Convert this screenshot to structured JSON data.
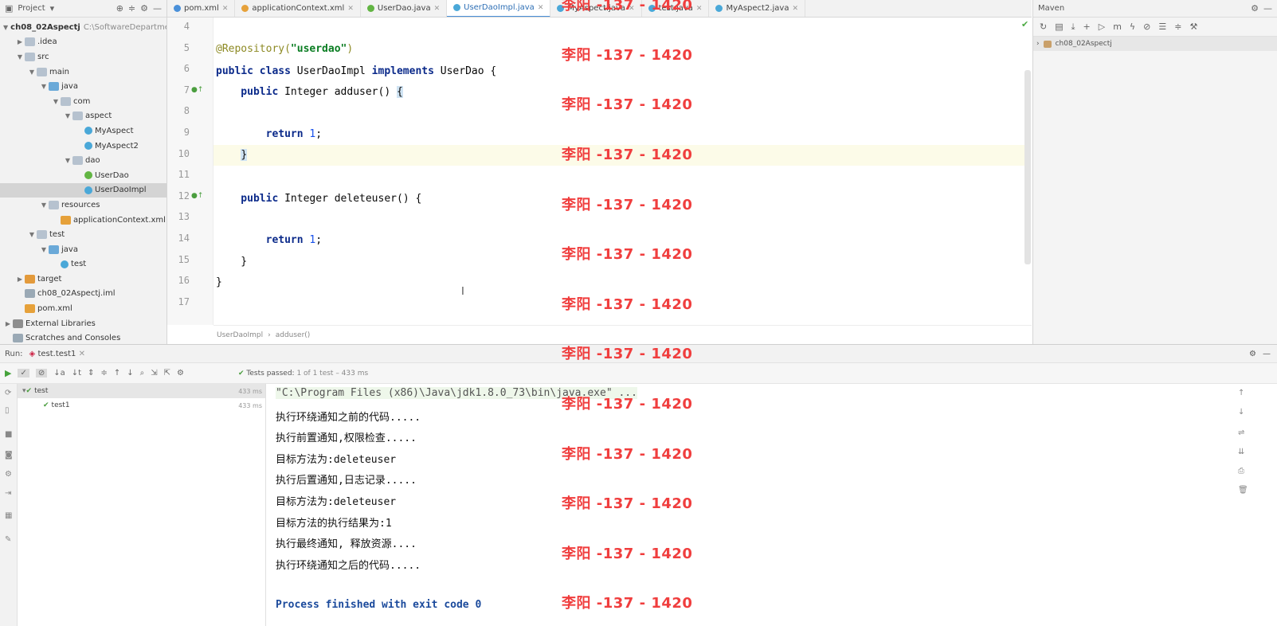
{
  "project": {
    "title": "Project",
    "tree": [
      {
        "label": "ch08_02Aspectj",
        "path": "C:\\SoftwareDepartme",
        "arrow": "v",
        "indent": 0,
        "icon": "folder",
        "bold": true
      },
      {
        "label": ".idea",
        "arrow": ">",
        "indent": 1,
        "icon": "folder"
      },
      {
        "label": "src",
        "arrow": "v",
        "indent": 1,
        "icon": "folder"
      },
      {
        "label": "main",
        "arrow": "v",
        "indent": 2,
        "icon": "folder"
      },
      {
        "label": "java",
        "arrow": "v",
        "indent": 3,
        "icon": "folder-blue"
      },
      {
        "label": "com",
        "arrow": "v",
        "indent": 4,
        "icon": "folder"
      },
      {
        "label": "aspect",
        "arrow": "v",
        "indent": 5,
        "icon": "folder"
      },
      {
        "label": "MyAspect",
        "arrow": "",
        "indent": 6,
        "icon": "class"
      },
      {
        "label": "MyAspect2",
        "arrow": "",
        "indent": 6,
        "icon": "class"
      },
      {
        "label": "dao",
        "arrow": "v",
        "indent": 5,
        "icon": "folder"
      },
      {
        "label": "UserDao",
        "arrow": "",
        "indent": 6,
        "icon": "iface"
      },
      {
        "label": "UserDaoImpl",
        "arrow": "",
        "indent": 6,
        "icon": "class",
        "selected": true
      },
      {
        "label": "resources",
        "arrow": "v",
        "indent": 3,
        "icon": "folder"
      },
      {
        "label": "applicationContext.xml",
        "arrow": "",
        "indent": 4,
        "icon": "xml"
      },
      {
        "label": "test",
        "arrow": "v",
        "indent": 2,
        "icon": "folder"
      },
      {
        "label": "java",
        "arrow": "v",
        "indent": 3,
        "icon": "folder-blue"
      },
      {
        "label": "test",
        "arrow": "",
        "indent": 4,
        "icon": "class"
      },
      {
        "label": "target",
        "arrow": ">",
        "indent": 1,
        "icon": "folder-orange"
      },
      {
        "label": "ch08_02Aspectj.iml",
        "arrow": "",
        "indent": 1,
        "icon": "file"
      },
      {
        "label": "pom.xml",
        "arrow": "",
        "indent": 1,
        "icon": "xml"
      },
      {
        "label": "External Libraries",
        "arrow": ">",
        "indent": 0,
        "icon": "lib"
      },
      {
        "label": "Scratches and Consoles",
        "arrow": "",
        "indent": 0,
        "icon": "file"
      }
    ]
  },
  "editor": {
    "tabs": [
      {
        "label": "pom.xml",
        "color": "#4a90d9"
      },
      {
        "label": "applicationContext.xml",
        "color": "#e6a13a"
      },
      {
        "label": "UserDao.java",
        "color": "#62b543"
      },
      {
        "label": "UserDaoImpl.java",
        "color": "#4aa8d8",
        "active": true
      },
      {
        "label": "MyAspect.java",
        "color": "#4aa8d8"
      },
      {
        "label": "test.java",
        "color": "#4aa8d8"
      },
      {
        "label": "MyAspect2.java",
        "color": "#4aa8d8"
      }
    ],
    "line_numbers": [
      "4",
      "5",
      "6",
      "7",
      "8",
      "9",
      "10",
      "11",
      "12",
      "13",
      "14",
      "15",
      "16",
      "17"
    ],
    "code": {
      "l5_ann": "@Repository(",
      "l5_str": "\"userdao\"",
      "l5_end": ")",
      "l6_kw1": "public class",
      "l6_name": " UserDaoImpl ",
      "l6_kw2": "implements",
      "l6_rest": " UserDao {",
      "l7_kw": "    public",
      "l7_rest": " Integer adduser() ",
      "l7_brace": "{",
      "l9_kw": "        return",
      "l9_num": " 1",
      "l9_end": ";",
      "l10_brace": "}",
      "l12_kw": "    public",
      "l12_rest": " Integer deleteuser() {",
      "l14_kw": "        return",
      "l14_num": " 1",
      "l14_end": ";",
      "l15": "    }",
      "l16": "}"
    },
    "breadcrumb": [
      "UserDaoImpl",
      "adduser()"
    ]
  },
  "maven": {
    "title": "Maven",
    "project_row": "ch08_02Aspectj"
  },
  "run": {
    "label": "Run:",
    "tab": "test.test1",
    "status_prefix": "Tests passed:",
    "status_rest": "1 of 1 test – 433 ms",
    "tests": [
      {
        "name": "test",
        "time": "433 ms",
        "indent": 0
      },
      {
        "name": "test1",
        "time": "433 ms",
        "indent": 1
      }
    ],
    "console": [
      "\"C:\\Program Files (x86)\\Java\\jdk1.8.0_73\\bin\\java.exe\" ...",
      "执行环绕通知之前的代码.....",
      "执行前置通知,权限检查.....",
      "目标方法为:deleteuser",
      "执行后置通知,日志记录.....",
      "目标方法为:deleteuser",
      "目标方法的执行结果为:1",
      "执行最终通知, 释放资源....",
      "执行环绕通知之后的代码.....",
      "",
      "Process finished with exit code 0"
    ]
  },
  "watermark": "李阳 -137 - 1420"
}
